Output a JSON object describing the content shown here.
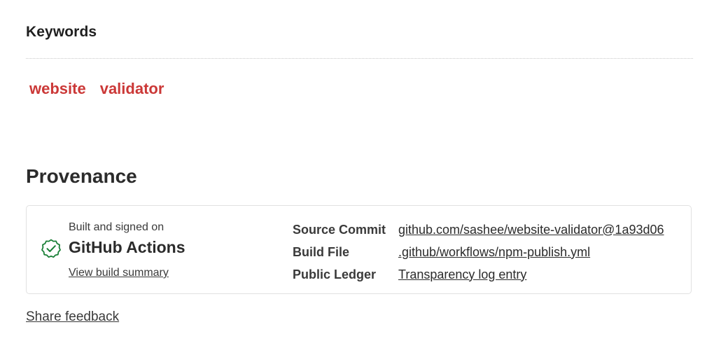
{
  "keywords_section": {
    "title": "Keywords",
    "items": [
      "website",
      "validator"
    ]
  },
  "provenance": {
    "title": "Provenance",
    "built_label": "Built and signed on",
    "platform": "GitHub Actions",
    "summary_link": "View build summary",
    "rows": [
      {
        "key": "Source Commit",
        "value": "github.com/sashee/website-validator@1a93d06"
      },
      {
        "key": "Build File",
        "value": ".github/workflows/npm-publish.yml"
      },
      {
        "key": "Public Ledger",
        "value": "Transparency log entry"
      }
    ],
    "status_icon": "check-badge-icon"
  },
  "feedback_link": "Share feedback",
  "colors": {
    "keyword": "#cb3837",
    "check": "#1a7f37"
  }
}
